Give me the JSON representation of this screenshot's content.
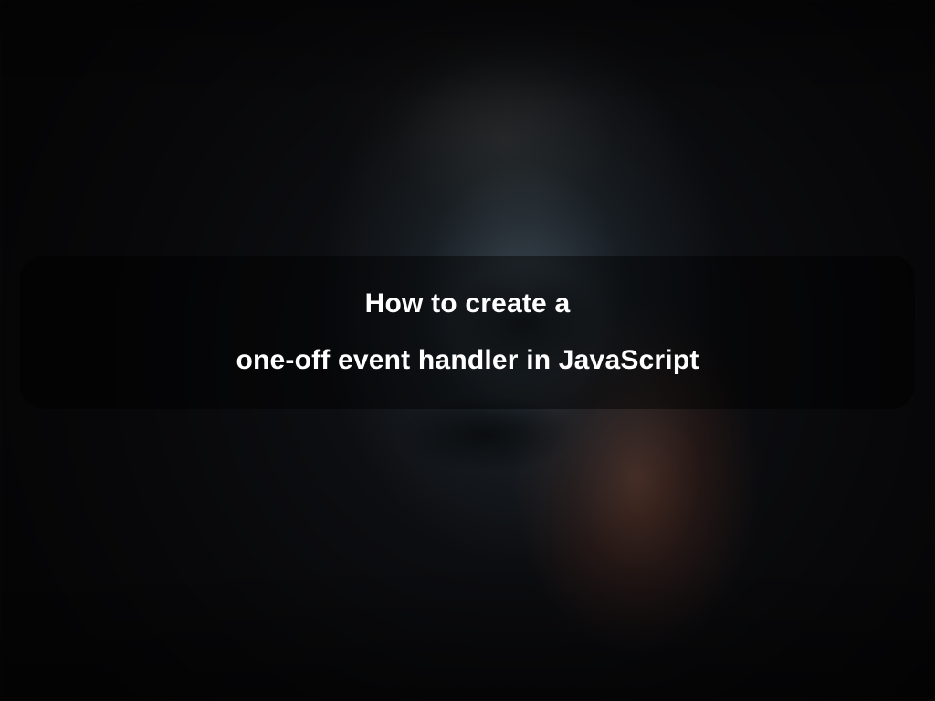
{
  "title": {
    "line1": "How to create a",
    "line2": "one-off event handler in JavaScript"
  }
}
